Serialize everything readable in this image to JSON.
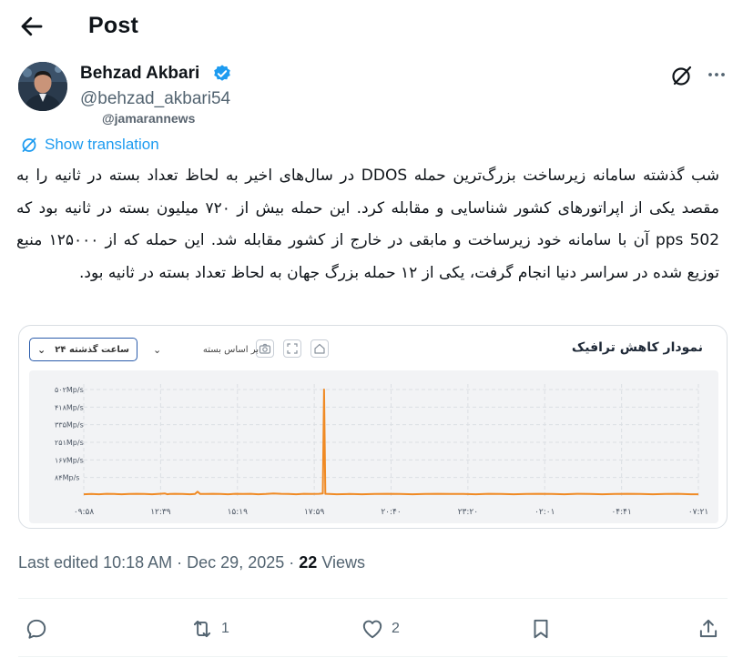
{
  "header": {
    "title": "Post"
  },
  "author": {
    "name": "Behzad Akbari",
    "handle": "@behzad_akbari54",
    "via": "@jamarannews"
  },
  "translation_label": "Show translation",
  "tweet_text": "شب گذشته سامانه زیرساخت بزرگ‌ترین حمله DDOS در سال‌های اخیر به لحاظ تعداد بسته در ثانیه را به مقصد یکی از اپراتورهای کشور شناسایی و مقابله کرد. این حمله بیش از ۷۲۰ میلیون بسته در ثانیه بود که 502 pps آن با سامانه خود زیرساخت و مابقی در خارج از کشور مقابله شد. این حمله که از ۱۲۵۰۰۰ منبع توزیع شده در سراسر دنیا انجام گرفت، یکی از ۱۲ حمله بزرگ جهان به لحاظ تعداد بسته در ثانیه بود.",
  "media": {
    "chart_title": "نمودار کاهش ترافیک",
    "basis_select": "بر اساس بسته",
    "range_select": "۲۴ ساعت گذشته"
  },
  "chart_data": {
    "type": "line",
    "title": "نمودار کاهش ترافیک",
    "y_ticks": [
      "۵۰۲Mp/s",
      "۴۱۸Mp/s",
      "۳۳۵Mp/s",
      "۲۵۱Mp/s",
      "۱۶۷Mp/s",
      "۸۴Mp/s"
    ],
    "y_tick_values": [
      502,
      418,
      335,
      251,
      167,
      84
    ],
    "ylim": [
      0,
      502
    ],
    "y_unit": "Mp/s",
    "x_ticks": [
      "۰۹:۵۸",
      "۱۲:۳۹",
      "۱۵:۱۹",
      "۱۷:۵۹",
      "۲۰:۴۰",
      "۲۳:۲۰",
      "۰۲:۰۱",
      "۰۴:۴۱",
      "۰۷:۲۱"
    ],
    "series": [
      {
        "color": "#f08a24",
        "x": [
          0,
          0.3,
          0.6,
          0.9,
          1.2,
          1.5,
          1.8,
          2.1,
          2.4,
          2.7,
          3.0,
          3.2,
          3.3,
          3.4,
          3.6,
          3.9,
          4.2,
          4.4,
          4.5,
          4.6,
          4.8,
          5.1,
          5.4,
          5.7,
          6.0,
          6.3,
          6.6,
          6.9,
          7.2,
          7.5,
          7.8,
          8.1,
          8.4,
          8.7,
          9.0,
          9.3,
          9.45,
          9.5,
          9.55,
          9.7,
          10.0,
          10.5,
          11.0,
          11.5,
          12.0,
          12.5,
          13.0,
          13.5,
          14.0,
          14.5,
          15.0,
          15.5,
          16.0,
          16.5,
          17.0,
          17.5,
          18.0,
          18.5,
          19.0,
          19.5,
          20.0,
          20.5,
          21.0,
          21.5,
          22.0,
          22.5,
          23.0,
          23.5,
          24.0,
          24.3
        ],
        "y": [
          4,
          5,
          4,
          6,
          5,
          4,
          5,
          6,
          5,
          4,
          6,
          8,
          4,
          5,
          6,
          5,
          4,
          5,
          16,
          5,
          5,
          6,
          5,
          4,
          6,
          5,
          6,
          4,
          5,
          8,
          6,
          5,
          4,
          6,
          5,
          6,
          8,
          502,
          6,
          5,
          4,
          5,
          4,
          5,
          6,
          5,
          4,
          5,
          6,
          5,
          5,
          4,
          6,
          5,
          4,
          5,
          6,
          5,
          4,
          6,
          5,
          4,
          5,
          6,
          5,
          4,
          5,
          6,
          4,
          4
        ]
      }
    ],
    "grid": true
  },
  "meta": {
    "edited": "Last edited 10:18 AM",
    "dot": "·",
    "date": "Dec 29, 2025",
    "views_count": "22",
    "views_label": "Views"
  },
  "actions": {
    "retweets": "1",
    "likes": "2"
  },
  "icons": {
    "back": "back-arrow-icon",
    "verified": "verified-badge-icon",
    "grok": "grok-icon",
    "more": "more-icon",
    "translate": "translate-icon",
    "reply": "reply-icon",
    "retweet": "retweet-icon",
    "like": "like-icon",
    "bookmark": "bookmark-icon",
    "share": "share-icon"
  },
  "colors": {
    "accent": "#1d9bf0",
    "series": "#f08a24",
    "select_border": "#2b5cab"
  }
}
